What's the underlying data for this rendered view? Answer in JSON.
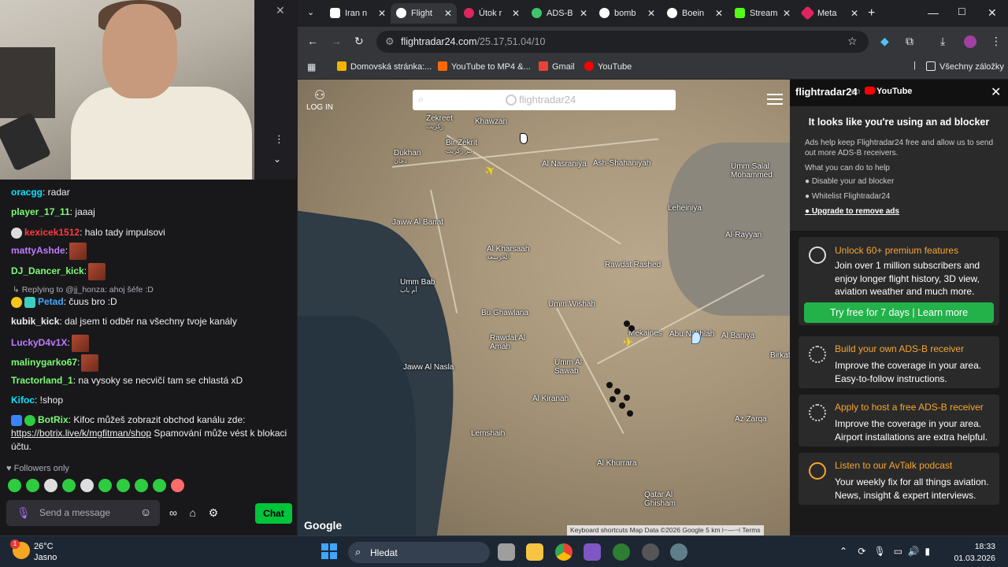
{
  "chat": {
    "messages": [
      {
        "user": "oracgg",
        "user_color": "#00e5ff",
        "text": ": radar"
      },
      {
        "user": "player_17_11",
        "user_color": "#7cfc74",
        "text": ": jaaaj"
      },
      {
        "user": "kexicek1512",
        "user_color": "#ff3b3b",
        "text": ": halo tady impulsovi"
      },
      {
        "user": "mattyAshde",
        "user_color": "#c07bff",
        "text": ":"
      },
      {
        "user": "DJ_Dancer_kick",
        "user_color": "#7cfc74",
        "text": ":"
      },
      {
        "user": "Petad",
        "user_color": "#3fa9ff",
        "text": ": čuus bro :D",
        "reply": "Replying to @jj_honza: ahoj šéfe :D"
      },
      {
        "user": "kubik_kick",
        "user_color": "#efeff1",
        "text": ": dal jsem ti odběr na všechny tvoje kanály"
      },
      {
        "user": "LuckyD4v1X",
        "user_color": "#c07bff",
        "text": ":"
      },
      {
        "user": "malinygarko67",
        "user_color": "#7cfc74",
        "text": ":"
      },
      {
        "user": "Tractorland_1",
        "user_color": "#7cfc74",
        "text": ": na vysoky se necvičí tam se chlastá xD"
      },
      {
        "user": "Kifoc",
        "user_color": "#00e5ff",
        "text": ": !shop"
      },
      {
        "user": "BotRix",
        "user_color": "#7cfc74",
        "text": ": Kifoc můžeš zobrazit obchod kanálu zde:",
        "link": "https://botrix.live/k/mgfitman/shop",
        "after": " Spamování může vést k blokaci účtu."
      }
    ],
    "followers_only": "Followers only",
    "placeholder": "Send a message",
    "chat_button": "Chat"
  },
  "browser": {
    "tabs": [
      {
        "label": "Iran n",
        "color": "#ffffff"
      },
      {
        "label": "Flight",
        "color": "#ffffff",
        "active": true
      },
      {
        "label": "Útok r",
        "color": "#e0245e"
      },
      {
        "label": "ADS-B",
        "color": "#3ec46d"
      },
      {
        "label": "bomb",
        "color": "#4285f4"
      },
      {
        "label": "Boein",
        "color": "#4285f4"
      },
      {
        "label": "Stream",
        "color": "#53fc18"
      },
      {
        "label": "Meta",
        "color": "#e0245e"
      }
    ],
    "url_host": "flightradar24.com",
    "url_path": "/25.17,51.04/10",
    "bookmarks": [
      {
        "label": "Domovská stránka:...",
        "color": "#f5b400"
      },
      {
        "label": "YouTube to MP4 &...",
        "color": "#ff6a00"
      },
      {
        "label": "Gmail",
        "color": "#ea4335"
      },
      {
        "label": "YouTube",
        "color": "#ff0000"
      }
    ],
    "all_bookmarks": "Všechny záložky"
  },
  "map": {
    "login": "LOG IN",
    "search_logo": "flightradar24",
    "google": "Google",
    "footer": "Keyboard shortcuts    Map Data ©2026 Google    5 km ⊢—⊣    Terms",
    "places": [
      {
        "name": "Zekreet",
        "ar": "زكريت"
      },
      {
        "name": "Khawzan"
      },
      {
        "name": "Bir Zekrit",
        "ar": "بير زكريت"
      },
      {
        "name": "Dukhan",
        "ar": "دخان"
      },
      {
        "name": "Al Nasraniya"
      },
      {
        "name": "Ash-Shahaniyah"
      },
      {
        "name": "Umm Salal Mohammed"
      },
      {
        "name": "Leheiniya"
      },
      {
        "name": "Jaww Al Banat"
      },
      {
        "name": "Al Kharsaah",
        "ar": "الخرسعة"
      },
      {
        "name": "Rawdat Rashed"
      },
      {
        "name": "Al-Rayyan"
      },
      {
        "name": "Umm Bab",
        "ar": "أم باب"
      },
      {
        "name": "Umm Wishah"
      },
      {
        "name": "Bu Ghawlana"
      },
      {
        "name": "Mekaines"
      },
      {
        "name": "Abu Nakhlah"
      },
      {
        "name": "Al Baniya"
      },
      {
        "name": "Rawdat Al Amah"
      },
      {
        "name": "Umm Al Sawab"
      },
      {
        "name": "Jaww Al Nasla"
      },
      {
        "name": "Al Kiranah"
      },
      {
        "name": "Lemshaih"
      },
      {
        "name": "Al Khurrara"
      },
      {
        "name": "Qatar Al Ghisham"
      },
      {
        "name": "Birkat"
      },
      {
        "name": "Az Zarqa"
      }
    ]
  },
  "panel": {
    "brand": "flightradar24",
    "on": "on",
    "youtube": "YouTube",
    "adblock_title": "It looks like you're using an ad blocker",
    "adblock_desc": "Ads help keep Flightradar24 free and allow us to send out more ADS-B receivers.",
    "what_you_can_do": "What you can do to help",
    "bullets": [
      "Disable your ad blocker",
      "Whitelist Flightradar24",
      "Upgrade to remove ads"
    ],
    "cards": [
      {
        "title": "Unlock 60+ premium features",
        "body": "Join over 1 million subscribers and enjoy longer flight history, 3D view, aviation weather and much more.",
        "button": "Try free for 7 days | Learn more"
      },
      {
        "title": "Build your own ADS-B receiver",
        "body": "Improve the coverage in your area. Easy-to-follow instructions."
      },
      {
        "title": "Apply to host a free ADS-B receiver",
        "body": "Improve the coverage in your area. Airport installations are extra helpful."
      },
      {
        "title": "Listen to our AvTalk podcast",
        "body": "Your weekly fix for all things aviation. News, insight & expert interviews."
      }
    ]
  },
  "taskbar": {
    "temp": "26°C",
    "weather": "Jasno",
    "weather_badge": "1",
    "search": "Hledat",
    "time": "18:33",
    "date": "01.03.2026"
  }
}
